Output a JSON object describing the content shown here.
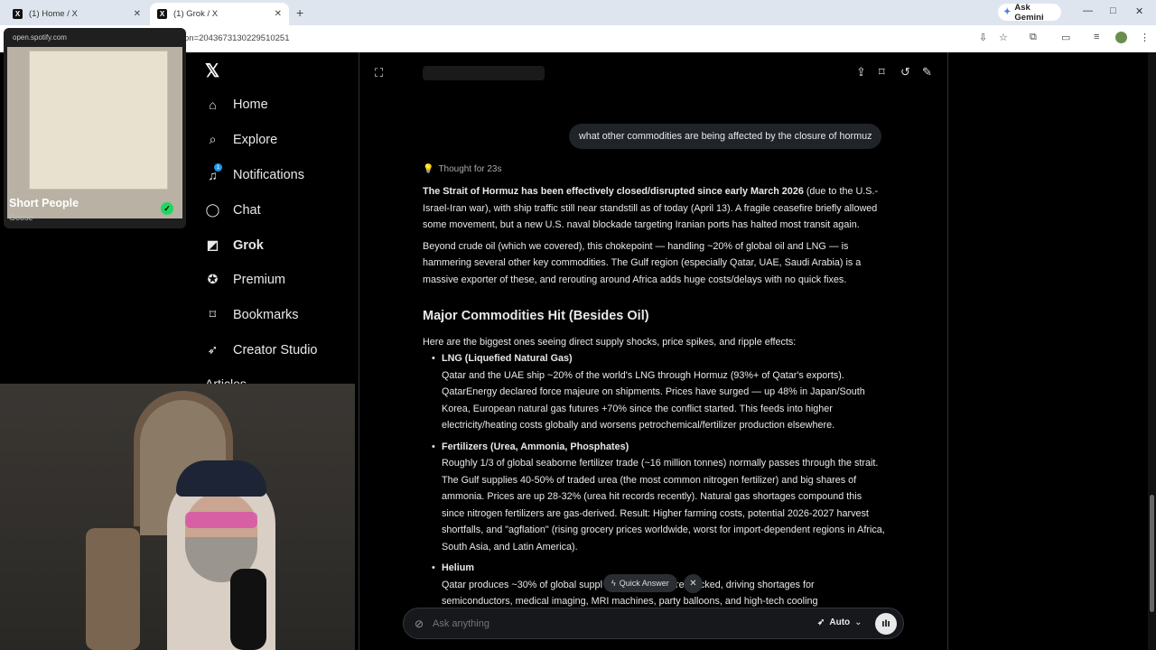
{
  "browser": {
    "tabs": [
      {
        "title": "(1) Home / X",
        "favicon": "X"
      },
      {
        "title": "(1) Grok / X",
        "favicon": "X"
      }
    ],
    "new_tab": "+",
    "gemini_label": "Ask Gemini",
    "url": "on=2043673130229510251",
    "window_controls": [
      "—",
      "□",
      "✕"
    ]
  },
  "spotify": {
    "source": "open.spotify.com",
    "track_title": "Short People",
    "artist": "Goose"
  },
  "sidebar": {
    "items": [
      {
        "label": "Home",
        "icon": "home-icon"
      },
      {
        "label": "Explore",
        "icon": "search-icon"
      },
      {
        "label": "Notifications",
        "icon": "bell-icon",
        "badge": "1"
      },
      {
        "label": "Chat",
        "icon": "chat-icon"
      },
      {
        "label": "Grok",
        "icon": "grok-icon"
      },
      {
        "label": "Premium",
        "icon": "premium-icon"
      },
      {
        "label": "Bookmarks",
        "icon": "bookmark-icon"
      },
      {
        "label": "Creator Studio",
        "icon": "rocket-icon"
      }
    ],
    "partial_item": "Articles"
  },
  "grok": {
    "user_message": "what other commodities are being affected by the closure of hormuz",
    "thought": "Thought for 23s",
    "p1_bold": "The Strait of Hormuz has been effectively closed/disrupted since early March 2026",
    "p1_rest": " (due to the U.S.-Israel-Iran war), with ship traffic still near standstill as of today (April 13). A fragile ceasefire briefly allowed some movement, but a new U.S. naval blockade targeting Iranian ports has halted most transit again.",
    "p2": "Beyond crude oil (which we covered), this chokepoint — handling ~20% of global oil and LNG — is hammering several other key commodities. The Gulf region (especially Qatar, UAE, Saudi Arabia) is a massive exporter of these, and rerouting around Africa adds huge costs/delays with no quick fixes.",
    "heading": "Major Commodities Hit (Besides Oil)",
    "intro": "Here are the biggest ones seeing direct supply shocks, price spikes, and ripple effects:",
    "items": [
      {
        "head": "LNG (Liquefied Natural Gas)",
        "body": "Qatar and the UAE ship ~20% of the world's LNG through Hormuz (93%+ of Qatar's exports). QatarEnergy declared force majeure on shipments. Prices have surged — up 48% in Japan/South Korea, European natural gas futures +70% since the conflict started. This feeds into higher electricity/heating costs globally and worsens petrochemical/fertilizer production elsewhere."
      },
      {
        "head": "Fertilizers (Urea, Ammonia, Phosphates)",
        "body": "Roughly 1/3 of global seaborne fertilizer trade (~16 million tonnes) normally passes through the strait. The Gulf supplies 40-50% of traded urea (the most common nitrogen fertilizer) and big shares of ammonia. Prices are up 28-32% (urea hit records recently). Natural gas shortages compound this since nitrogen fertilizers are gas-derived. Result: Higher farming costs, potential 2026-2027 harvest shortfalls, and \"agflation\" (rising grocery prices worldwide, worst for import-dependent regions in Africa, South Asia, and Latin America)."
      },
      {
        "head": "Helium",
        "body": "Qatar produces ~30% of global suppl           ct). Shipments are blocked, driving shortages for semiconductors, medical imaging, MRI machines, party balloons, and high-tech cooling"
      }
    ],
    "quick_answer": "Quick Answer",
    "ask_placeholder": "Ask anything",
    "mode": "Auto"
  }
}
